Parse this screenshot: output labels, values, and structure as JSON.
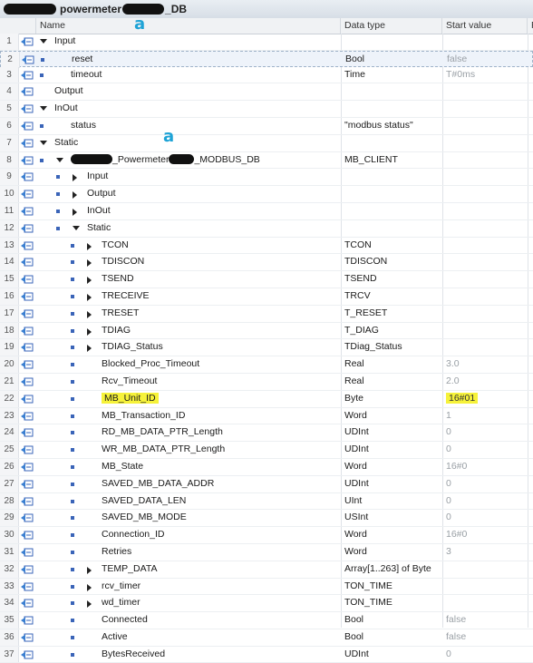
{
  "title": {
    "prefix": "powermeter",
    "suffix": "_DB"
  },
  "columns": {
    "name": "Name",
    "data_type": "Data type",
    "start_value": "Start value",
    "extra": "R"
  },
  "annotations": {
    "mark1": "a",
    "mark2": "a"
  },
  "rows": [
    {
      "num": "1",
      "name": "Input",
      "type": "",
      "value": ""
    },
    {
      "num": "2",
      "name": "reset",
      "type": "Bool",
      "value": "false"
    },
    {
      "num": "3",
      "name": "timeout",
      "type": "Time",
      "value": "T#0ms"
    },
    {
      "num": "4",
      "name": "Output",
      "type": "",
      "value": ""
    },
    {
      "num": "5",
      "name": "InOut",
      "type": "",
      "value": ""
    },
    {
      "num": "6",
      "name": "status",
      "type": "\"modbus status\"",
      "value": ""
    },
    {
      "num": "7",
      "name": "Static",
      "type": "",
      "value": ""
    },
    {
      "num": "8",
      "name": "_Powermeter",
      "name2": "_MODBUS_DB",
      "type": "MB_CLIENT",
      "value": ""
    },
    {
      "num": "9",
      "name": "Input",
      "type": "",
      "value": ""
    },
    {
      "num": "10",
      "name": "Output",
      "type": "",
      "value": ""
    },
    {
      "num": "11",
      "name": "InOut",
      "type": "",
      "value": ""
    },
    {
      "num": "12",
      "name": "Static",
      "type": "",
      "value": ""
    },
    {
      "num": "13",
      "name": "TCON",
      "type": "TCON",
      "value": ""
    },
    {
      "num": "14",
      "name": "TDISCON",
      "type": "TDISCON",
      "value": ""
    },
    {
      "num": "15",
      "name": "TSEND",
      "type": "TSEND",
      "value": ""
    },
    {
      "num": "16",
      "name": "TRECEIVE",
      "type": "TRCV",
      "value": ""
    },
    {
      "num": "17",
      "name": "TRESET",
      "type": "T_RESET",
      "value": ""
    },
    {
      "num": "18",
      "name": "TDIAG",
      "type": "T_DIAG",
      "value": ""
    },
    {
      "num": "19",
      "name": "TDIAG_Status",
      "type": "TDiag_Status",
      "value": ""
    },
    {
      "num": "20",
      "name": "Blocked_Proc_Timeout",
      "type": "Real",
      "value": "3.0"
    },
    {
      "num": "21",
      "name": "Rcv_Timeout",
      "type": "Real",
      "value": "2.0"
    },
    {
      "num": "22",
      "name": "MB_Unit_ID",
      "type": "Byte",
      "value": "16#01"
    },
    {
      "num": "23",
      "name": "MB_Transaction_ID",
      "type": "Word",
      "value": "1"
    },
    {
      "num": "24",
      "name": "RD_MB_DATA_PTR_Length",
      "type": "UDInt",
      "value": "0"
    },
    {
      "num": "25",
      "name": "WR_MB_DATA_PTR_Length",
      "type": "UDInt",
      "value": "0"
    },
    {
      "num": "26",
      "name": "MB_State",
      "type": "Word",
      "value": "16#0"
    },
    {
      "num": "27",
      "name": "SAVED_MB_DATA_ADDR",
      "type": "UDInt",
      "value": "0"
    },
    {
      "num": "28",
      "name": "SAVED_DATA_LEN",
      "type": "UInt",
      "value": "0"
    },
    {
      "num": "29",
      "name": "SAVED_MB_MODE",
      "type": "USInt",
      "value": "0"
    },
    {
      "num": "30",
      "name": "Connection_ID",
      "type": "Word",
      "value": "16#0"
    },
    {
      "num": "31",
      "name": "Retries",
      "type": "Word",
      "value": "3"
    },
    {
      "num": "32",
      "name": "TEMP_DATA",
      "type": "Array[1..263] of Byte",
      "value": ""
    },
    {
      "num": "33",
      "name": "rcv_timer",
      "type": "TON_TIME",
      "value": ""
    },
    {
      "num": "34",
      "name": "wd_timer",
      "type": "TON_TIME",
      "value": ""
    },
    {
      "num": "35",
      "name": "Connected",
      "type": "Bool",
      "value": "false"
    },
    {
      "num": "36",
      "name": "Active",
      "type": "Bool",
      "value": "false"
    },
    {
      "num": "37",
      "name": "BytesReceived",
      "type": "UDInt",
      "value": "0"
    }
  ]
}
